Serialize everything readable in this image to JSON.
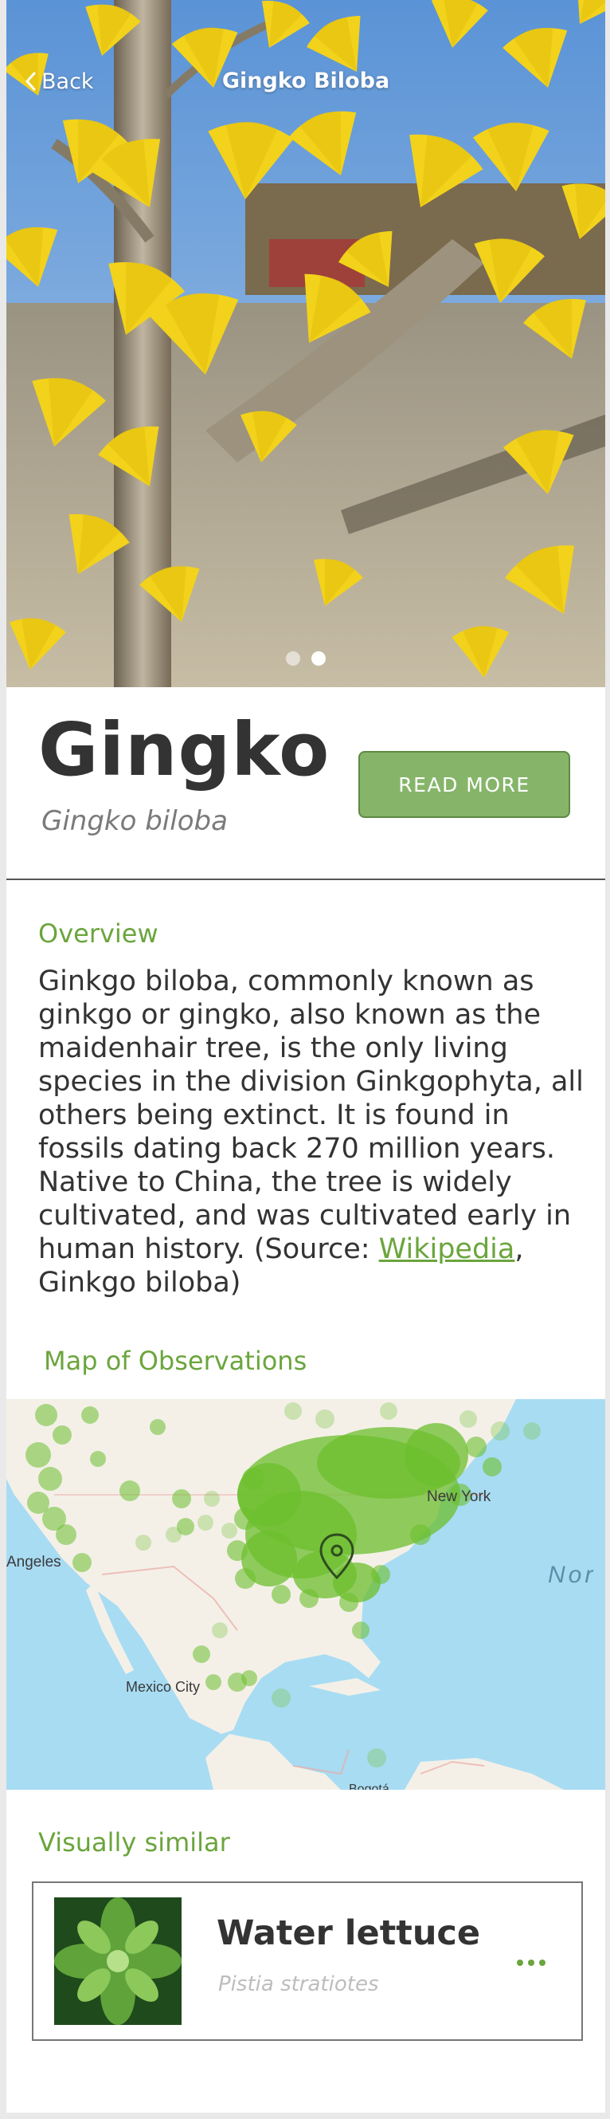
{
  "nav": {
    "back_label": "Back",
    "title": "Gingko Biloba"
  },
  "gallery": {
    "image_count": 2,
    "active_index": 1
  },
  "plant": {
    "common_name": "Gingko",
    "scientific_name": "Gingko biloba",
    "read_more_label": "READ MORE"
  },
  "overview": {
    "heading": "Overview",
    "text": "Ginkgo biloba, commonly known as ginkgo or gingko, also known as the maidenhair tree, is the only living species in the division Ginkgophyta, all others being extinct. It is found in fossils dating back 270 million years. Native to China, the tree is widely cultivated, and was cultivated early in human history. (Source: ",
    "source_link": "Wikipedia",
    "source_suffix": ", Ginkgo biloba)"
  },
  "map": {
    "heading": "Map of Observations",
    "labels": {
      "new_york": "New York",
      "los_angeles": "Angeles",
      "mexico_city": "Mexico City",
      "bogota": "Bogotá",
      "ocean": "Nor"
    }
  },
  "similar": {
    "heading": "Visually similar",
    "items": [
      {
        "common_name": "Water lettuce",
        "scientific_name": "Pistia stratiotes"
      }
    ]
  },
  "colors": {
    "accent_green": "#6ba53d",
    "button_green": "#86b56a",
    "text_dark": "#333333",
    "text_muted": "#7a7a7a"
  }
}
